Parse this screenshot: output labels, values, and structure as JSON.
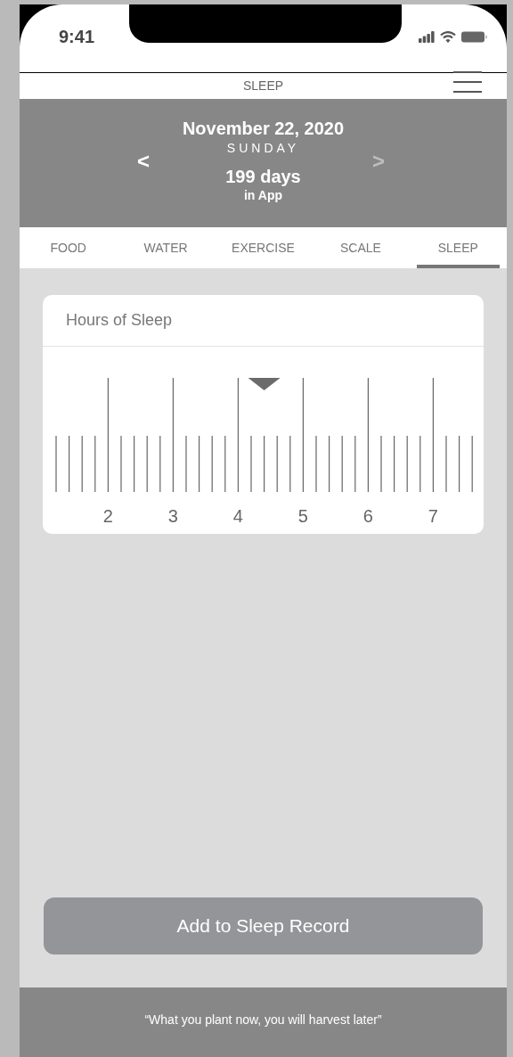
{
  "status_bar": {
    "time": "9:41"
  },
  "header": {
    "title": "SLEEP"
  },
  "date_panel": {
    "date": "November 22, 2020",
    "weekday": "SUNDAY",
    "days": "199 days",
    "days_caption": "in App",
    "nav": [
      {
        "label": "<",
        "disabled": false
      },
      {
        "label": ">",
        "disabled": true
      }
    ]
  },
  "tabs": [
    {
      "label": "FOOD",
      "selected": false
    },
    {
      "label": "WATER",
      "selected": false
    },
    {
      "label": "EXERCISE",
      "selected": false
    },
    {
      "label": "SCALE",
      "selected": false
    },
    {
      "label": "SLEEP",
      "selected": true
    }
  ],
  "card": {
    "title": "Hours of Sleep",
    "ruler": {
      "level": 0.5,
      "labels": [
        "2",
        "3",
        "4",
        "5",
        "6",
        "7"
      ]
    }
  },
  "button": {
    "label": "Add to Sleep Record"
  },
  "footer": {
    "quote": "“What you plant now, you will harvest later”"
  }
}
